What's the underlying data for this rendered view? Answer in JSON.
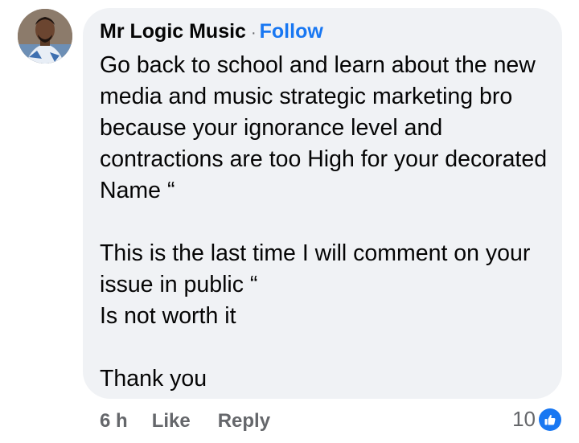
{
  "comment": {
    "author": "Mr Logic Music",
    "separator": "·",
    "follow_label": "Follow",
    "text": "Go back to school and learn about the new media and music strategic marketing bro because your ignorance level and contractions are too High for your decorated Name “\n\nThis is the last time I will comment on your issue in public “\nIs not worth it\n\nThank you",
    "time": "6 h",
    "like_label": "Like",
    "reply_label": "Reply",
    "reaction_count": "10",
    "reaction_icon": "thumbs-up-icon"
  },
  "colors": {
    "bubble": "#f0f2f5",
    "link": "#1877f2",
    "secondary_text": "#65676b",
    "primary_text": "#050505"
  }
}
